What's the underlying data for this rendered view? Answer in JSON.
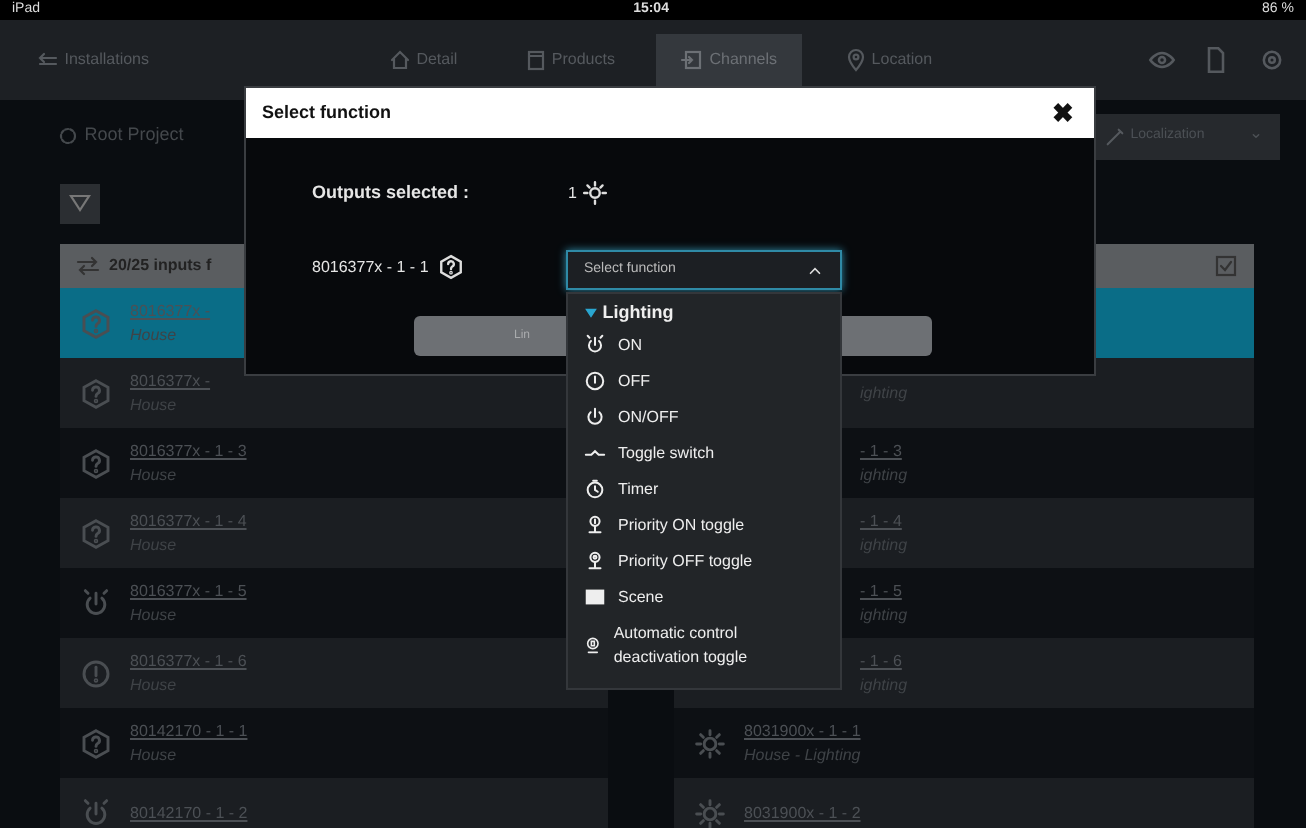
{
  "status_bar": {
    "device": "iPad",
    "time": "15:04",
    "battery": "86 %"
  },
  "nav": {
    "back": "Installations",
    "tabs": [
      {
        "label": "Detail",
        "selected": false
      },
      {
        "label": "Products",
        "selected": false
      },
      {
        "label": "Channels",
        "selected": true
      },
      {
        "label": "Location",
        "selected": false
      }
    ]
  },
  "toolbar": {
    "project": "Root Project",
    "localization": "Localization"
  },
  "inputs_panel": {
    "header": "20/25 inputs f",
    "rows": [
      {
        "code": "8016377x - ",
        "place": "House",
        "kind": "question",
        "selected": true
      },
      {
        "code": "8016377x - ",
        "place": "House",
        "kind": "question",
        "selected": false
      },
      {
        "code": "8016377x - 1 - 3",
        "place": "House",
        "kind": "question",
        "selected": false
      },
      {
        "code": "8016377x - 1 - 4",
        "place": "House",
        "kind": "question",
        "selected": false
      },
      {
        "code": "8016377x - 1 - 5",
        "place": "House",
        "kind": "power",
        "selected": false
      },
      {
        "code": "8016377x - 1 - 6",
        "place": "House",
        "kind": "info",
        "selected": false
      },
      {
        "code": "80142170 - 1 - 1",
        "place": "House",
        "kind": "question",
        "selected": false
      },
      {
        "code": "80142170 - 1 - 2",
        "kind": "power",
        "selected": false
      }
    ]
  },
  "outputs_panel": {
    "rows": [
      {
        "selected": true
      },
      {
        "place": "ighting",
        "selected": false
      },
      {
        "code": "- 1 - 3",
        "place": "ighting",
        "selected": false
      },
      {
        "code": "- 1 - 4",
        "place": "ighting",
        "selected": false
      },
      {
        "code": "- 1 - 5",
        "place": "ighting",
        "selected": false
      },
      {
        "code": "- 1 - 6",
        "place": "ighting",
        "selected": false
      },
      {
        "code": "8031900x - 1 - 1",
        "place": "House - Lighting",
        "kind": "lamp",
        "selected": false
      },
      {
        "code": "8031900x - 1 - 2",
        "kind": "lamp",
        "selected": false
      }
    ]
  },
  "dialog": {
    "title": "Select function",
    "close": "✖",
    "outputs_label": "Outputs selected :",
    "outputs_count": "1",
    "input_name": "8016377x - 1 - 1",
    "select_placeholder": "Select function",
    "button": "Lin",
    "dropdown": {
      "group": "Lighting",
      "expanded": true,
      "items": [
        {
          "label": "ON",
          "kind": "on"
        },
        {
          "label": "OFF",
          "kind": "off"
        },
        {
          "label": "ON/OFF",
          "kind": "onoff"
        },
        {
          "label": "Toggle switch",
          "kind": "toggle"
        },
        {
          "label": "Timer",
          "kind": "timer"
        },
        {
          "label": "Priority ON toggle",
          "kind": "prio_on"
        },
        {
          "label": "Priority OFF toggle",
          "kind": "prio_off"
        },
        {
          "label": "Scene",
          "kind": "scene"
        },
        {
          "label": "Automatic control deactivation toggle",
          "kind": "auto"
        }
      ]
    }
  }
}
